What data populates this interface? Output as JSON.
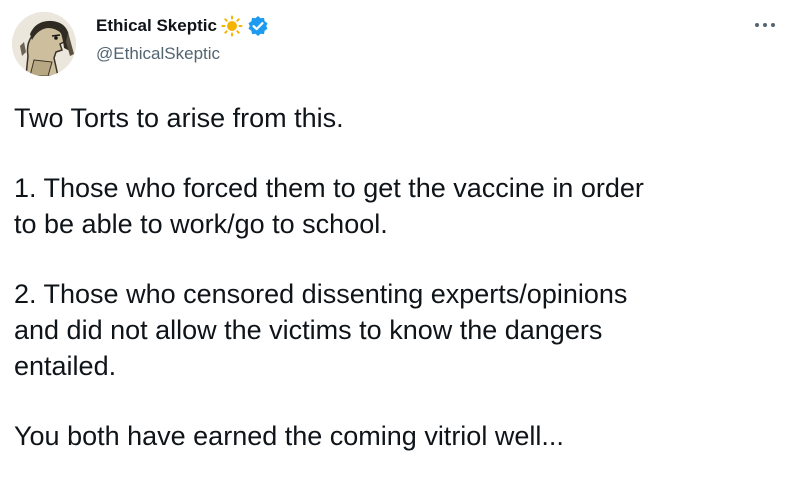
{
  "author": {
    "display_name": "Ethical Skeptic",
    "handle": "@EthicalSkeptic",
    "name_emoji": "sun-icon",
    "verified_icon": "verified-badge-icon",
    "verified_color": "#1d9bf0",
    "sun_color": "#f4b400"
  },
  "menu": {
    "more_icon": "more-options-icon"
  },
  "tweet": {
    "paragraphs": [
      [
        "Two Torts to arise from this."
      ],
      [
        "1. Those who forced them to get the vaccine in order",
        "to be able to work/go to school."
      ],
      [
        "2. Those who censored dissenting experts/opinions",
        "and did not allow the victims to know the dangers",
        "entailed."
      ],
      [
        "You both have earned the coming vitriol well..."
      ]
    ]
  }
}
